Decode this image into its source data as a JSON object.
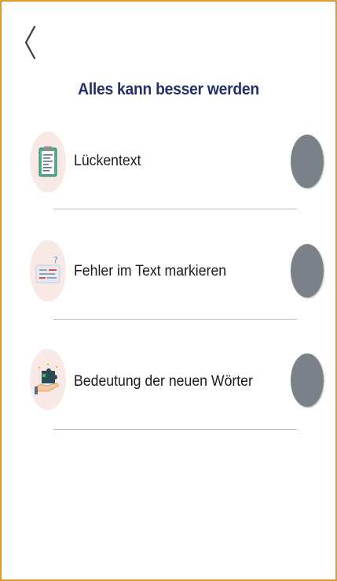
{
  "header": {
    "back_icon": "chevron-left-icon",
    "title": "Alles kann besser werden"
  },
  "items": [
    {
      "label": "Lückentext",
      "icon": "clipboard-icon"
    },
    {
      "label": "Fehler im Text markieren",
      "icon": "text-question-icon"
    },
    {
      "label": "Bedeutung der neuen Wörter",
      "icon": "hand-puzzle-icon"
    }
  ],
  "colors": {
    "frame_border": "#e39a2c",
    "title": "#24306b",
    "toggle": "#7a8189",
    "divider": "#9ccbb9",
    "icon_background": "#f9e9e6"
  }
}
